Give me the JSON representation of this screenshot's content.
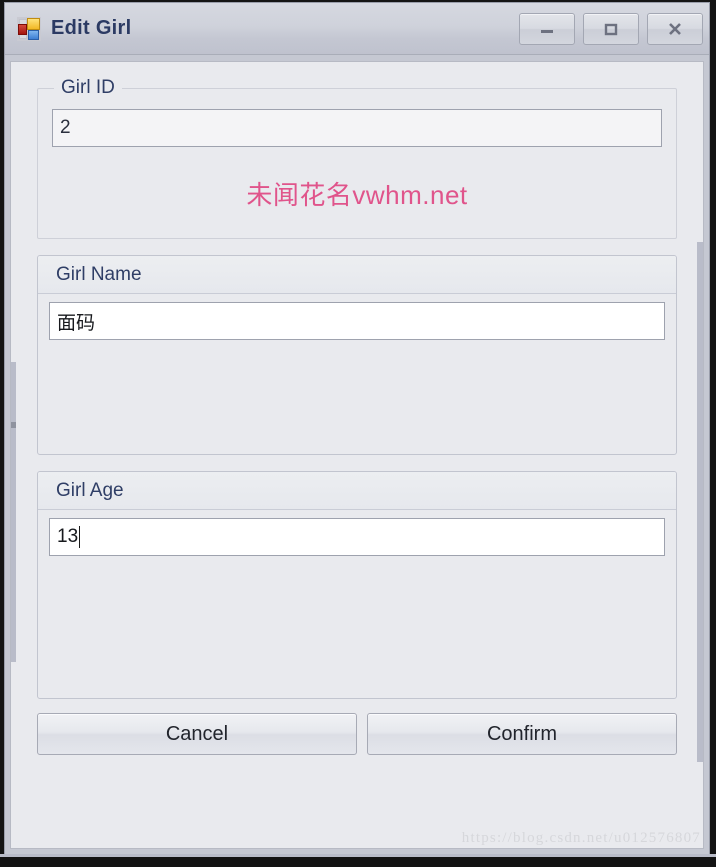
{
  "window": {
    "title": "Edit Girl",
    "icon": "winform-app-icon",
    "controls": [
      {
        "name": "minimize",
        "glyph": "minimize-icon"
      },
      {
        "name": "maximize",
        "glyph": "maximize-icon"
      },
      {
        "name": "close",
        "glyph": "close-icon"
      }
    ]
  },
  "form": {
    "girl_id": {
      "legend": "Girl ID",
      "value": "2",
      "readonly": true,
      "watermark": "未闻花名vwhm.net",
      "watermark_color": "#e0548b"
    },
    "girl_name": {
      "header": "Girl Name",
      "value": "面码",
      "placeholder": ""
    },
    "girl_age": {
      "header": "Girl Age",
      "value": "13",
      "placeholder": "",
      "focused": true
    }
  },
  "buttons": {
    "cancel": "Cancel",
    "confirm": "Confirm"
  },
  "watermark": {
    "csdn": "https://blog.csdn.net/u012576807"
  },
  "colors": {
    "title_text": "#2b3a63",
    "label_text": "#2f3e66",
    "client_bg": "#e9eaee",
    "frame": "#c5c8d2",
    "accent_pink": "#e0548b"
  }
}
